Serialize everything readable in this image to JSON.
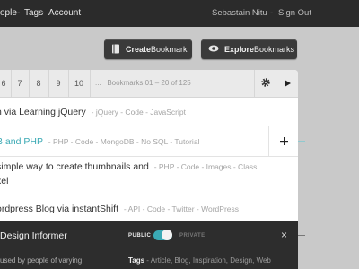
{
  "header": {
    "nav": [
      "ople",
      "Tags",
      "Account"
    ],
    "user_name": "Sebastain Nitu",
    "sign_out": "Sign Out"
  },
  "actions": {
    "create_strong": "Create",
    "create_rest": " Bookmark",
    "explore_strong": "Explore",
    "explore_rest": " Bookmarks"
  },
  "pager": {
    "pages": [
      "6",
      "7",
      "8",
      "9",
      "10"
    ],
    "ellipsis": "...",
    "info": "Bookmarks 01 – 20 of 125"
  },
  "bookmarks": [
    {
      "title": "n via Learning jQuery",
      "tags": "-  jQuery  -  Code  -  JavaScript"
    },
    {
      "title": "B and PHP",
      "tags": "-  PHP  -  Code  -  MongoDB  -  No SQL  -  Tutorial"
    },
    {
      "title": "simple way to create thumbnails and",
      "title2": "xel",
      "tags": "-  PHP  -  Code  -  Images  -  Class"
    },
    {
      "title": "ordpress Blog via instantShift",
      "tags": "-  API  -  Code  -  Twitter  -  WordPress"
    }
  ],
  "edit_panel": {
    "title": "Design Informer",
    "public_label": "PUBLIC",
    "private_label": "PRIVATE",
    "visibility_public_on": true,
    "close_symbol": "×",
    "description": "used by people of varying",
    "tags_label": "Tags",
    "tags_value": " - Article, Blog, Inspiration, Design, Web"
  },
  "colors": {
    "accent": "#3aa9b4",
    "topbar": "#2b2b2b",
    "darkbar": "#2d2d2d",
    "background": "#c9c9c9"
  },
  "icons": {
    "create": "book-icon",
    "explore": "eye-icon",
    "settings": "gear-icon",
    "next": "play-arrow-icon",
    "add": "plus-icon",
    "close": "close-icon"
  }
}
